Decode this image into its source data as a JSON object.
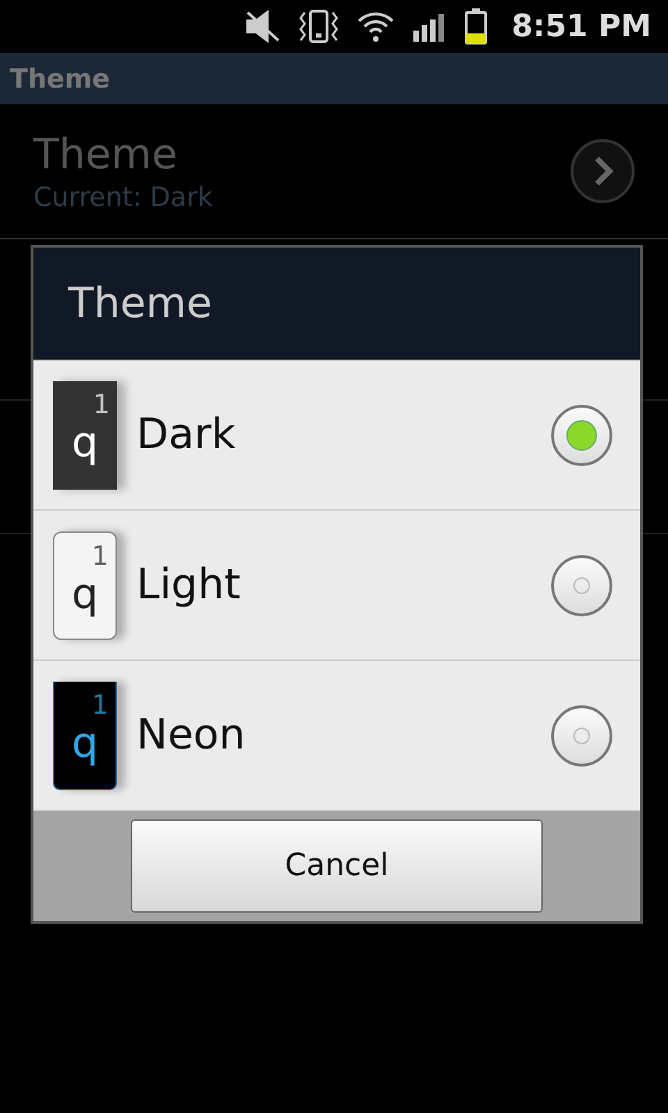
{
  "status_bar": {
    "time": "8:51 PM"
  },
  "title_bar": {
    "title": "Theme"
  },
  "setting": {
    "title": "Theme",
    "summary": "Current: Dark"
  },
  "dialog": {
    "title": "Theme",
    "options": [
      {
        "label": "Dark",
        "kind": "dark",
        "key_hint": "1",
        "key_label": "q",
        "selected": true
      },
      {
        "label": "Light",
        "kind": "light",
        "key_hint": "1",
        "key_label": "q",
        "selected": false
      },
      {
        "label": "Neon",
        "kind": "neon",
        "key_hint": "1",
        "key_label": "q",
        "selected": false
      }
    ],
    "cancel": "Cancel"
  }
}
